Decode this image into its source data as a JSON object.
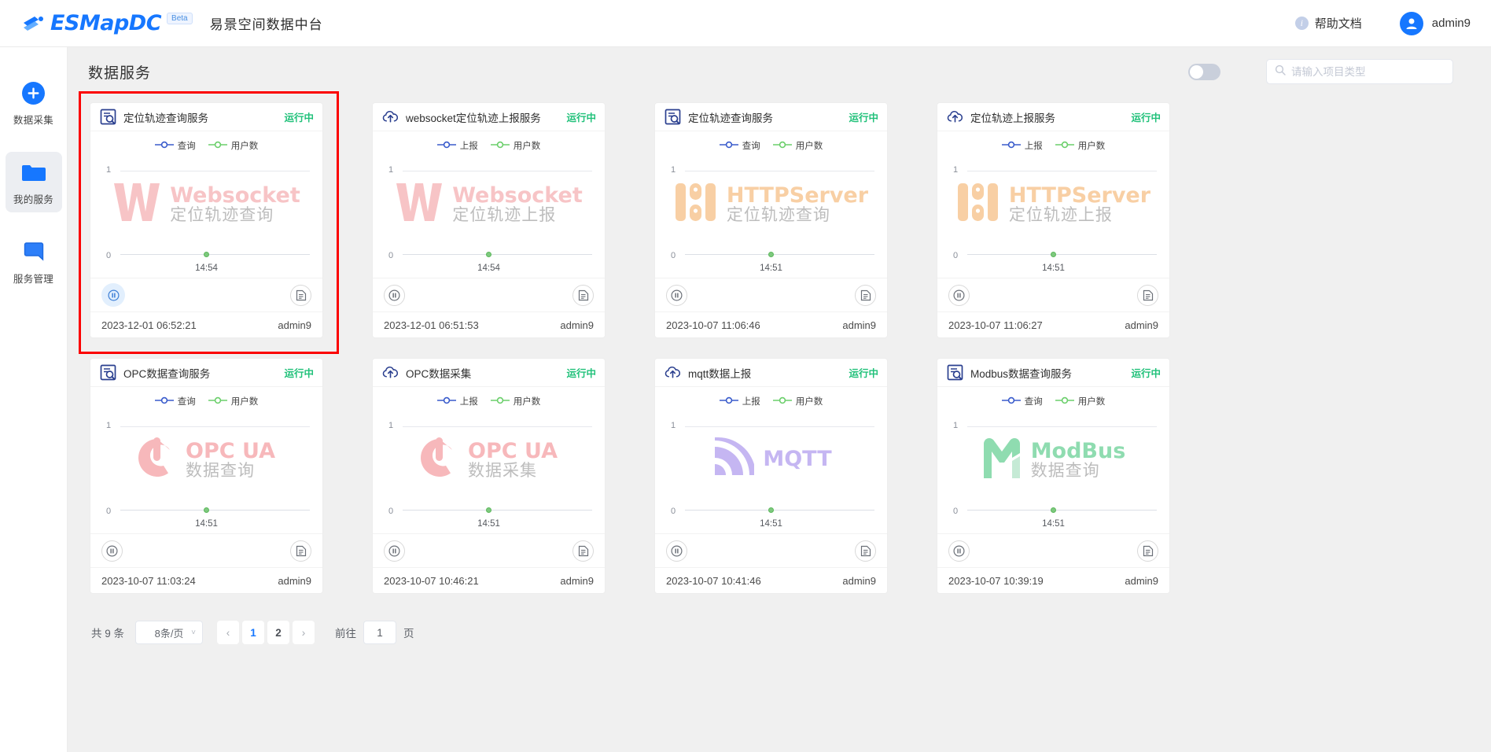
{
  "header": {
    "brand_name": "ESMapDC",
    "beta_label": "Beta",
    "brand_subtitle": "易景空间数据中台",
    "help_label": "帮助文档",
    "user_name": "admin9",
    "brand_color": "#1677ff"
  },
  "sidebar": {
    "items": [
      {
        "label": "数据采集",
        "icon": "plus-circle-icon",
        "active": false
      },
      {
        "label": "我的服务",
        "icon": "folder-icon",
        "active": true
      },
      {
        "label": "服务管理",
        "icon": "bookmark-icon",
        "active": false
      }
    ]
  },
  "main": {
    "page_title": "数据服务",
    "toggle_on": false,
    "search_placeholder": "请输入项目类型",
    "search_value": "",
    "search_icon": "search-icon"
  },
  "cards": [
    {
      "title": "定位轨迹查询服务",
      "icon": "query-doc-icon",
      "status": "运行中",
      "status_color": "#21c17a",
      "legend": [
        {
          "label": "查询",
          "color": "#3a5ccc"
        },
        {
          "label": "用户数",
          "color": "#6bcf6b"
        }
      ],
      "watermark_en": "Websocket",
      "watermark_cn": "定位轨迹查询",
      "watermark_logo": "websocket-w-logo",
      "watermark_color": "#f7c4c6",
      "time": "2023-12-01 06:52:21",
      "owner": "admin9",
      "selected": true,
      "action_primary_active": true,
      "chart_data": {
        "type": "line",
        "title": "定位轨迹查询服务",
        "x": [
          "14:54"
        ],
        "xlabel": "",
        "ylabel": "",
        "ylim": [
          0,
          1
        ],
        "ytick_labels": [
          "0",
          "1"
        ],
        "grid": true,
        "legend_position": "top",
        "series": [
          {
            "name": "查询",
            "color": "#3a5ccc",
            "values": [
              0
            ]
          },
          {
            "name": "用户数",
            "color": "#6bcf6b",
            "values": [
              0
            ]
          }
        ]
      }
    },
    {
      "title": "websocket定位轨迹上报服务",
      "icon": "cloud-upload-icon",
      "status": "运行中",
      "status_color": "#21c17a",
      "legend": [
        {
          "label": "上报",
          "color": "#3a5ccc"
        },
        {
          "label": "用户数",
          "color": "#6bcf6b"
        }
      ],
      "watermark_en": "Websocket",
      "watermark_cn": "定位轨迹上报",
      "watermark_logo": "websocket-w-logo",
      "watermark_color": "#f7c4c6",
      "time": "2023-12-01 06:51:53",
      "owner": "admin9",
      "selected": false,
      "action_primary_active": false,
      "chart_data": {
        "type": "line",
        "title": "websocket定位轨迹上报服务",
        "x": [
          "14:54"
        ],
        "ylim": [
          0,
          1
        ],
        "ytick_labels": [
          "0",
          "1"
        ],
        "grid": true,
        "legend_position": "top",
        "series": [
          {
            "name": "上报",
            "color": "#3a5ccc",
            "values": [
              0
            ]
          },
          {
            "name": "用户数",
            "color": "#6bcf6b",
            "values": [
              0
            ]
          }
        ]
      }
    },
    {
      "title": "定位轨迹查询服务",
      "icon": "query-doc-icon",
      "status": "运行中",
      "status_color": "#21c17a",
      "legend": [
        {
          "label": "查询",
          "color": "#3a5ccc"
        },
        {
          "label": "用户数",
          "color": "#6bcf6b"
        }
      ],
      "watermark_en": "HTTPServer",
      "watermark_cn": "定位轨迹查询",
      "watermark_logo": "http-bars-logo",
      "watermark_color": "#f8cfa4",
      "time": "2023-10-07 11:06:46",
      "owner": "admin9",
      "selected": false,
      "action_primary_active": false,
      "chart_data": {
        "type": "line",
        "title": "定位轨迹查询服务",
        "x": [
          "14:51"
        ],
        "ylim": [
          0,
          1
        ],
        "ytick_labels": [
          "0",
          "1"
        ],
        "grid": true,
        "legend_position": "top",
        "series": [
          {
            "name": "查询",
            "color": "#3a5ccc",
            "values": [
              0
            ]
          },
          {
            "name": "用户数",
            "color": "#6bcf6b",
            "values": [
              0
            ]
          }
        ]
      }
    },
    {
      "title": "定位轨迹上报服务",
      "icon": "cloud-upload-icon",
      "status": "运行中",
      "status_color": "#21c17a",
      "legend": [
        {
          "label": "上报",
          "color": "#3a5ccc"
        },
        {
          "label": "用户数",
          "color": "#6bcf6b"
        }
      ],
      "watermark_en": "HTTPServer",
      "watermark_cn": "定位轨迹上报",
      "watermark_logo": "http-bars-logo",
      "watermark_color": "#f8cfa4",
      "time": "2023-10-07 11:06:27",
      "owner": "admin9",
      "selected": false,
      "action_primary_active": false,
      "chart_data": {
        "type": "line",
        "title": "定位轨迹上报服务",
        "x": [
          "14:51"
        ],
        "ylim": [
          0,
          1
        ],
        "ytick_labels": [
          "0",
          "1"
        ],
        "grid": true,
        "legend_position": "top",
        "series": [
          {
            "name": "上报",
            "color": "#3a5ccc",
            "values": [
              0
            ]
          },
          {
            "name": "用户数",
            "color": "#6bcf6b",
            "values": [
              0
            ]
          }
        ]
      }
    },
    {
      "title": "OPC数据查询服务",
      "icon": "query-doc-icon",
      "status": "运行中",
      "status_color": "#21c17a",
      "legend": [
        {
          "label": "查询",
          "color": "#3a5ccc"
        },
        {
          "label": "用户数",
          "color": "#6bcf6b"
        }
      ],
      "watermark_en": "OPC UA",
      "watermark_cn": "数据查询",
      "watermark_logo": "opc-ua-logo",
      "watermark_color": "#f7b8bb",
      "time": "2023-10-07 11:03:24",
      "owner": "admin9",
      "selected": false,
      "action_primary_active": false,
      "chart_data": {
        "type": "line",
        "title": "OPC数据查询服务",
        "x": [
          "14:51"
        ],
        "ylim": [
          0,
          1
        ],
        "ytick_labels": [
          "0",
          "1"
        ],
        "grid": true,
        "legend_position": "top",
        "series": [
          {
            "name": "查询",
            "color": "#3a5ccc",
            "values": [
              0
            ]
          },
          {
            "name": "用户数",
            "color": "#6bcf6b",
            "values": [
              0
            ]
          }
        ]
      }
    },
    {
      "title": "OPC数据采集",
      "icon": "cloud-upload-icon",
      "status": "运行中",
      "status_color": "#21c17a",
      "legend": [
        {
          "label": "上报",
          "color": "#3a5ccc"
        },
        {
          "label": "用户数",
          "color": "#6bcf6b"
        }
      ],
      "watermark_en": "OPC UA",
      "watermark_cn": "数据采集",
      "watermark_logo": "opc-ua-logo",
      "watermark_color": "#f7b8bb",
      "time": "2023-10-07 10:46:21",
      "owner": "admin9",
      "selected": false,
      "action_primary_active": false,
      "chart_data": {
        "type": "line",
        "title": "OPC数据采集",
        "x": [
          "14:51"
        ],
        "ylim": [
          0,
          1
        ],
        "ytick_labels": [
          "0",
          "1"
        ],
        "grid": true,
        "legend_position": "top",
        "series": [
          {
            "name": "上报",
            "color": "#3a5ccc",
            "values": [
              0
            ]
          },
          {
            "name": "用户数",
            "color": "#6bcf6b",
            "values": [
              0
            ]
          }
        ]
      }
    },
    {
      "title": "mqtt数据上报",
      "icon": "cloud-upload-icon",
      "status": "运行中",
      "status_color": "#21c17a",
      "legend": [
        {
          "label": "上报",
          "color": "#3a5ccc"
        },
        {
          "label": "用户数",
          "color": "#6bcf6b"
        }
      ],
      "watermark_en": "MQTT",
      "watermark_cn": "",
      "watermark_logo": "mqtt-waves-logo",
      "watermark_color": "#c5b6f2",
      "time": "2023-10-07 10:41:46",
      "owner": "admin9",
      "selected": false,
      "action_primary_active": false,
      "chart_data": {
        "type": "line",
        "title": "mqtt数据上报",
        "x": [
          "14:51"
        ],
        "ylim": [
          0,
          1
        ],
        "ytick_labels": [
          "0",
          "1"
        ],
        "grid": true,
        "legend_position": "top",
        "series": [
          {
            "name": "上报",
            "color": "#3a5ccc",
            "values": [
              0
            ]
          },
          {
            "name": "用户数",
            "color": "#6bcf6b",
            "values": [
              0
            ]
          }
        ]
      }
    },
    {
      "title": "Modbus数据查询服务",
      "icon": "query-doc-icon",
      "status": "运行中",
      "status_color": "#21c17a",
      "legend": [
        {
          "label": "查询",
          "color": "#3a5ccc"
        },
        {
          "label": "用户数",
          "color": "#6bcf6b"
        }
      ],
      "watermark_en": "ModBus",
      "watermark_cn": "数据查询",
      "watermark_logo": "modbus-m-logo",
      "watermark_color": "#8fdcb0",
      "time": "2023-10-07 10:39:19",
      "owner": "admin9",
      "selected": false,
      "action_primary_active": false,
      "chart_data": {
        "type": "line",
        "title": "Modbus数据查询服务",
        "x": [
          "14:51"
        ],
        "ylim": [
          0,
          1
        ],
        "ytick_labels": [
          "0",
          "1"
        ],
        "grid": true,
        "legend_position": "top",
        "series": [
          {
            "name": "查询",
            "color": "#3a5ccc",
            "values": [
              0
            ]
          },
          {
            "name": "用户数",
            "color": "#6bcf6b",
            "values": [
              0
            ]
          }
        ]
      }
    }
  ],
  "pagination": {
    "total_label": "共 9 条",
    "page_size_label": "8条/页",
    "prev_label": "‹",
    "next_label": "›",
    "pages": [
      "1",
      "2"
    ],
    "current_page": "1",
    "goto_label": "前往",
    "goto_value": "1",
    "goto_unit": "页"
  }
}
